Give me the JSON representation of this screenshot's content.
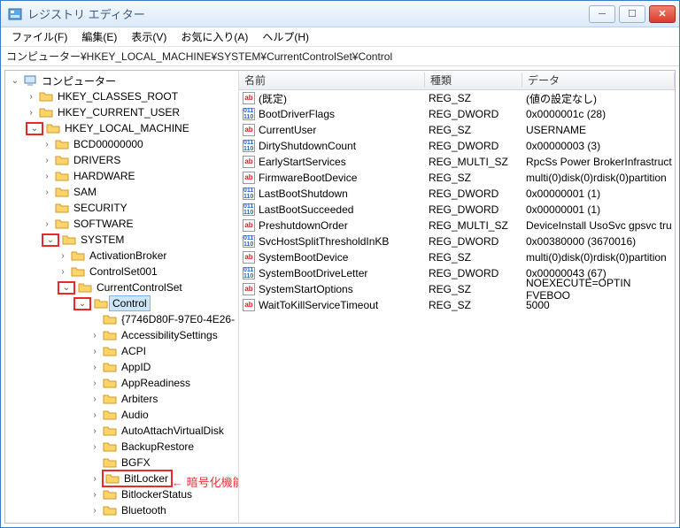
{
  "window": {
    "title": "レジストリ エディター"
  },
  "menu": {
    "file": "ファイル(F)",
    "edit": "編集(E)",
    "view": "表示(V)",
    "favorites": "お気に入り(A)",
    "help": "ヘルプ(H)"
  },
  "address": "コンピューター¥HKEY_LOCAL_MACHINE¥SYSTEM¥CurrentControlSet¥Control",
  "tree": {
    "root": {
      "label": "コンピューター",
      "glyph": "open"
    },
    "hkcr": {
      "label": "HKEY_CLASSES_ROOT"
    },
    "hkcu": {
      "label": "HKEY_CURRENT_USER"
    },
    "hklm": {
      "label": "HKEY_LOCAL_MACHINE",
      "glyph": "open"
    },
    "bcd": {
      "label": "BCD00000000"
    },
    "drivers": {
      "label": "DRIVERS"
    },
    "hardware": {
      "label": "HARDWARE"
    },
    "sam": {
      "label": "SAM"
    },
    "security": {
      "label": "SECURITY"
    },
    "software": {
      "label": "SOFTWARE"
    },
    "system": {
      "label": "SYSTEM",
      "glyph": "open"
    },
    "activation": {
      "label": "ActivationBroker"
    },
    "cset001": {
      "label": "ControlSet001"
    },
    "ccs": {
      "label": "CurrentControlSet",
      "glyph": "open"
    },
    "control": {
      "label": "Control",
      "glyph": "open"
    },
    "guid": {
      "label": "{7746D80F-97E0-4E26-"
    },
    "acc": {
      "label": "AccessibilitySettings"
    },
    "acpi": {
      "label": "ACPI"
    },
    "appid": {
      "label": "AppID"
    },
    "appready": {
      "label": "AppReadiness"
    },
    "arbiters": {
      "label": "Arbiters"
    },
    "audio": {
      "label": "Audio"
    },
    "autoattach": {
      "label": "AutoAttachVirtualDisk"
    },
    "backup": {
      "label": "BackupRestore"
    },
    "bgfx": {
      "label": "BGFX"
    },
    "bitlocker": {
      "label": "BitLocker"
    },
    "bitlockerstatus": {
      "label": "BitlockerStatus"
    },
    "bluetooth": {
      "label": "Bluetooth"
    }
  },
  "columns": {
    "name": "名前",
    "type": "種類",
    "data": "データ"
  },
  "values": [
    {
      "icon": "str",
      "name": "(既定)",
      "type": "REG_SZ",
      "data": "(値の設定なし)"
    },
    {
      "icon": "bin",
      "name": "BootDriverFlags",
      "type": "REG_DWORD",
      "data": "0x0000001c (28)"
    },
    {
      "icon": "str",
      "name": "CurrentUser",
      "type": "REG_SZ",
      "data": "USERNAME"
    },
    {
      "icon": "bin",
      "name": "DirtyShutdownCount",
      "type": "REG_DWORD",
      "data": "0x00000003 (3)"
    },
    {
      "icon": "str",
      "name": "EarlyStartServices",
      "type": "REG_MULTI_SZ",
      "data": "RpcSs Power BrokerInfrastruct"
    },
    {
      "icon": "str",
      "name": "FirmwareBootDevice",
      "type": "REG_SZ",
      "data": "multi(0)disk(0)rdisk(0)partition"
    },
    {
      "icon": "bin",
      "name": "LastBootShutdown",
      "type": "REG_DWORD",
      "data": "0x00000001 (1)"
    },
    {
      "icon": "bin",
      "name": "LastBootSucceeded",
      "type": "REG_DWORD",
      "data": "0x00000001 (1)"
    },
    {
      "icon": "str",
      "name": "PreshutdownOrder",
      "type": "REG_MULTI_SZ",
      "data": "DeviceInstall UsoSvc gpsvc tru"
    },
    {
      "icon": "bin",
      "name": "SvcHostSplitThresholdInKB",
      "type": "REG_DWORD",
      "data": "0x00380000 (3670016)"
    },
    {
      "icon": "str",
      "name": "SystemBootDevice",
      "type": "REG_SZ",
      "data": "multi(0)disk(0)rdisk(0)partition"
    },
    {
      "icon": "bin",
      "name": "SystemBootDriveLetter",
      "type": "REG_DWORD",
      "data": "0x00000043 (67)"
    },
    {
      "icon": "str",
      "name": "SystemStartOptions",
      "type": "REG_SZ",
      "data": " NOEXECUTE=OPTIN  FVEBOO"
    },
    {
      "icon": "str",
      "name": "WaitToKillServiceTimeout",
      "type": "REG_SZ",
      "data": "5000"
    }
  ],
  "annotation": "←  暗号化機能 BitLocker のレジストリキー"
}
